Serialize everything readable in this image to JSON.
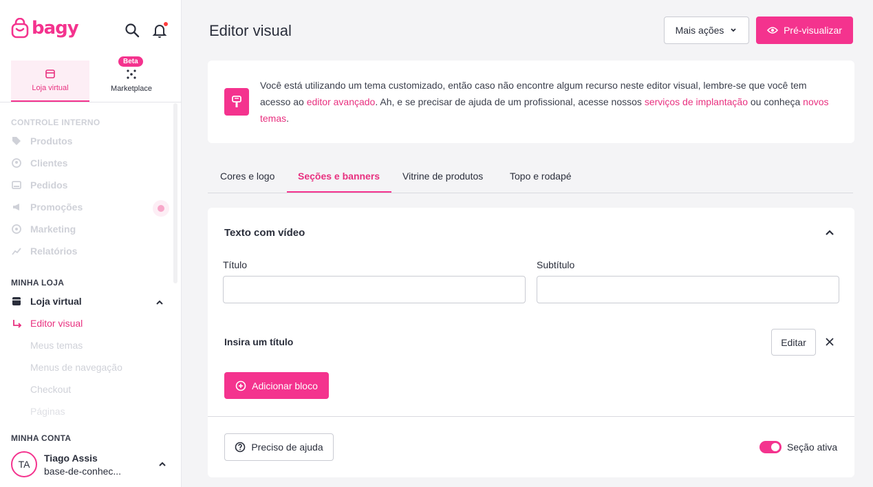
{
  "brand": {
    "name": "bagy",
    "accent": "#f4338e"
  },
  "modes": [
    {
      "label": "Loja virtual"
    },
    {
      "label": "Marketplace",
      "badge": "Beta"
    }
  ],
  "sidebar": {
    "section_internal": "CONTROLE INTERNO",
    "internal_items": [
      "Produtos",
      "Clientes",
      "Pedidos",
      "Promoções",
      "Marketing",
      "Relatórios"
    ],
    "section_store": "MINHA LOJA",
    "store_item": "Loja virtual",
    "store_subitems": [
      "Editor visual",
      "Meus temas",
      "Menus de navegação",
      "Checkout",
      "Páginas"
    ],
    "section_account": "MINHA CONTA",
    "user": {
      "initials": "TA",
      "name": "Tiago Assis",
      "store": "base-de-conhec..."
    }
  },
  "header": {
    "title": "Editor visual",
    "more_actions": "Mais ações",
    "preview": "Pré-visualizar"
  },
  "info": {
    "t1": "Você está utilizando um tema customizado, então caso não encontre algum recurso neste editor visual, lembre-se que você tem acesso ao ",
    "link1": "editor avançado",
    "t2": ". Ah, e se precisar de ajuda de um profissional, acesse nossos ",
    "link2": "serviços de implantação",
    "t3": " ou conheça ",
    "link3": "novos temas",
    "t4": "."
  },
  "tabs": [
    "Cores e logo",
    "Seções e banners",
    "Vitrine de produtos",
    "Topo e rodapé"
  ],
  "section": {
    "title": "Texto com vídeo",
    "field_title_label": "Título",
    "field_title_value": "",
    "field_subtitle_label": "Subtítulo",
    "field_subtitle_value": "",
    "block_title": "Insira um título",
    "edit_button": "Editar",
    "add_block": "Adicionar bloco",
    "help_button": "Preciso de ajuda",
    "active_label": "Seção ativa",
    "active": true
  }
}
